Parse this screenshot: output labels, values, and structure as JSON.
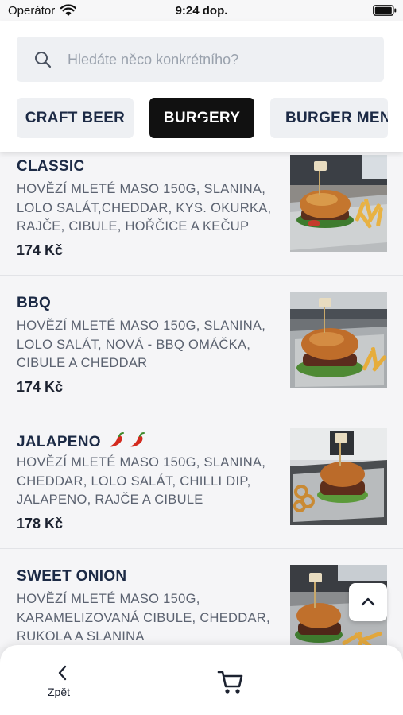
{
  "status_bar": {
    "carrier": "Operátor",
    "time": "9:24 dop."
  },
  "search": {
    "placeholder": "Hledáte něco konkrétního?"
  },
  "categories": [
    {
      "label": "CRAFT BEER",
      "active": false
    },
    {
      "label": "BURGERY",
      "active": true
    },
    {
      "label": "BURGER MENU",
      "active": false
    }
  ],
  "menu_items": [
    {
      "name": "CLASSIC",
      "description": "HOVĚZÍ MLETÉ MASO 150G, SLANINA, LOLO SALÁT,CHEDDAR, KYS. OKURKA, RAJČE, CIBULE, HOŘČICE A KEČUP",
      "price": "174 Kč"
    },
    {
      "name": "BBQ",
      "description": "HOVĚZÍ MLETÉ MASO 150G, SLANINA, LOLO SALÁT, NOVÁ - BBQ OMÁČKA, CIBULE A CHEDDAR",
      "price": "174 Kč"
    },
    {
      "name": "JALAPENO",
      "description": "HOVĚZÍ MLETÉ MASO 150G, SLANINA, CHEDDAR, LOLO SALÁT, CHILLI DIP, JALAPENO, RAJČE A CIBULE",
      "price": "178 Kč",
      "icons": [
        "chili-pepper-icon",
        "chili-pepper-icon"
      ]
    },
    {
      "name": "SWEET ONION",
      "description": "HOVĚZÍ MLETÉ MASO 150G, KARAMELIZOVANÁ CIBULE, CHEDDAR, RUKOLA A SLANINA",
      "price": ""
    }
  ],
  "bottom_bar": {
    "back_label": "Zpět",
    "icons": [
      "chevron-left-icon",
      "cart-icon"
    ]
  },
  "colors": {
    "active_tab": "#111111",
    "inactive_tab": "#eef0f3",
    "text_dark": "#1c2a45",
    "text_muted": "#5b6270"
  }
}
